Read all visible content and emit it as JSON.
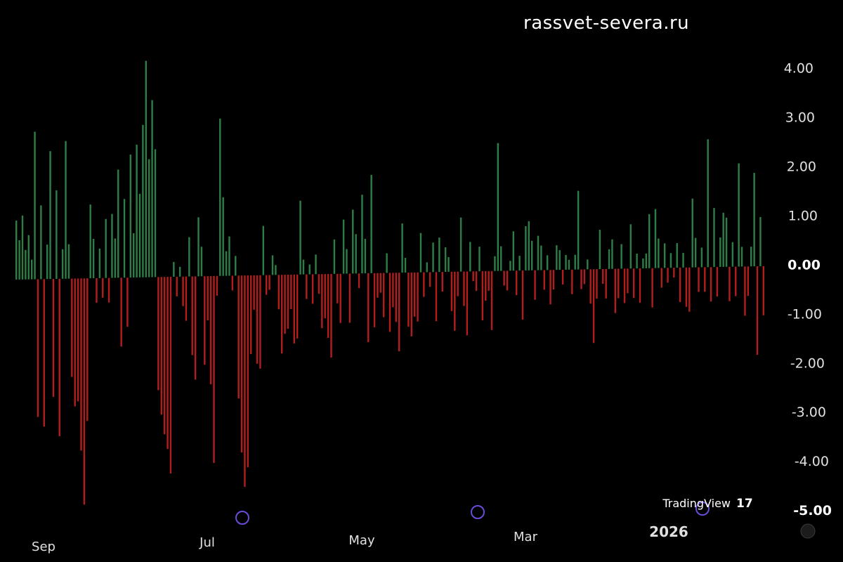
{
  "watermark_text": "rassvet-severa.ru",
  "chart_data": {
    "type": "bar",
    "title": "",
    "xlabel": "",
    "ylabel": "",
    "ylim": [
      -5,
      4.5
    ],
    "y_ticks": [
      "4.00",
      "3.00",
      "2.00",
      "1.00",
      "0.00",
      "-1.00",
      "-2.00",
      "-3.00",
      "-4.00",
      "-5.00"
    ],
    "x_ticks": [
      "Sep",
      "Jul",
      "May",
      "Mar",
      "2026"
    ],
    "grid": false,
    "logo_text": "TradingView",
    "logo_mark": "17",
    "event_markers": 3,
    "colors": {
      "positive": "#2e7d46",
      "negative": "#b01e1e",
      "axis_text": "#e0e0e0",
      "marker": "#6a4cd6"
    },
    "values": [
      1.2,
      0.8,
      1.3,
      0.6,
      0.9,
      0.4,
      3.0,
      -2.8,
      1.5,
      -3.0,
      0.7,
      2.6,
      -2.4,
      1.8,
      -3.2,
      0.6,
      2.8,
      0.7,
      -2.0,
      -2.6,
      -2.5,
      -3.5,
      -4.6,
      -2.9,
      1.5,
      0.8,
      -0.5,
      0.6,
      -0.4,
      1.2,
      -0.5,
      1.3,
      0.8,
      2.2,
      -1.4,
      1.6,
      -1.0,
      2.5,
      0.9,
      2.7,
      1.7,
      3.1,
      4.4,
      2.4,
      3.6,
      2.6,
      -2.3,
      -2.8,
      -3.2,
      -3.5,
      -4.0,
      0.3,
      -0.4,
      0.2,
      -0.6,
      -0.9,
      0.8,
      -1.6,
      -2.1,
      1.2,
      0.6,
      -1.8,
      -0.9,
      -2.2,
      -3.8,
      -0.4,
      3.2,
      1.6,
      0.5,
      0.8,
      -0.3,
      0.4,
      -2.5,
      -3.6,
      -4.3,
      -3.9,
      -1.6,
      -0.7,
      -1.8,
      -1.9,
      1.0,
      -0.4,
      -0.3,
      0.4,
      0.2,
      -0.7,
      -1.6,
      -1.2,
      -1.1,
      -0.7,
      -1.4,
      -1.3,
      1.5,
      0.3,
      -0.5,
      0.2,
      -0.6,
      0.4,
      -0.4,
      -1.1,
      -0.9,
      -1.3,
      -1.7,
      0.7,
      -0.6,
      -1.0,
      1.1,
      0.5,
      -1.0,
      1.3,
      0.8,
      -0.3,
      1.6,
      0.7,
      -1.4,
      2.0,
      -1.1,
      -0.5,
      -0.4,
      -0.9,
      0.4,
      -1.2,
      -0.7,
      -1.0,
      -1.6,
      1.0,
      0.3,
      -1.1,
      -1.3,
      -0.9,
      -1.0,
      0.8,
      -0.5,
      0.2,
      -0.3,
      0.6,
      -1.0,
      0.7,
      -0.4,
      0.5,
      0.3,
      -0.8,
      -1.2,
      -0.5,
      1.1,
      -0.7,
      -1.3,
      0.6,
      -0.2,
      -0.4,
      0.5,
      -1.0,
      -0.6,
      -0.4,
      -1.2,
      0.3,
      2.6,
      0.5,
      -0.3,
      -0.4,
      0.2,
      0.8,
      -0.5,
      0.3,
      -1.0,
      0.9,
      1.0,
      0.6,
      -0.6,
      0.7,
      0.5,
      -0.4,
      0.3,
      -0.7,
      -0.4,
      0.5,
      0.4,
      -0.3,
      0.3,
      0.2,
      -0.5,
      0.3,
      1.6,
      -0.4,
      -0.3,
      0.2,
      -0.7,
      -1.5,
      -0.6,
      0.8,
      -0.3,
      -0.6,
      0.4,
      0.6,
      -0.9,
      -0.6,
      0.5,
      -0.7,
      -0.5,
      0.9,
      -0.6,
      0.3,
      -0.7,
      0.2,
      0.3,
      1.1,
      -0.8,
      1.2,
      0.6,
      -0.4,
      0.5,
      -0.3,
      0.3,
      -0.2,
      0.5,
      -0.7,
      0.3,
      -0.8,
      -0.9,
      1.4,
      0.6,
      -0.5,
      0.4,
      -0.5,
      2.6,
      -0.7,
      1.2,
      -0.6,
      0.6,
      1.1,
      1.0,
      -0.7,
      0.5,
      -0.6,
      2.1,
      0.4,
      -1.0,
      -0.6,
      0.4,
      1.9,
      -1.8,
      1.0,
      -1.0
    ]
  }
}
